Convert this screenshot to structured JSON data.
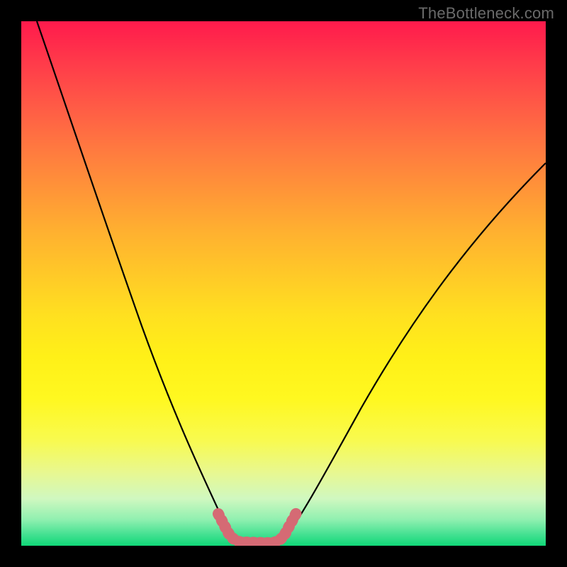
{
  "watermark": "TheBottleneck.com",
  "chart_data": {
    "type": "line",
    "title": "",
    "xlabel": "",
    "ylabel": "",
    "xlim": [
      0,
      100
    ],
    "ylim": [
      0,
      100
    ],
    "grid": false,
    "legend": false,
    "series": [
      {
        "name": "left-curve",
        "x": [
          3,
          10,
          18,
          25,
          30,
          35,
          40
        ],
        "y": [
          100,
          73,
          46,
          27,
          15,
          7,
          1
        ]
      },
      {
        "name": "right-curve",
        "x": [
          50,
          55,
          60,
          68,
          78,
          88,
          98
        ],
        "y": [
          1,
          6,
          14,
          28,
          45,
          60,
          73
        ]
      },
      {
        "name": "floor-band",
        "x": [
          38,
          40,
          43,
          47,
          50,
          52
        ],
        "y": [
          4,
          1,
          0,
          0,
          1,
          4
        ]
      }
    ],
    "colors": {
      "curve": "#000000",
      "floor_band": "#d56a74",
      "gradient_top": "#ff1a4c",
      "gradient_mid": "#fff018",
      "gradient_bottom": "#10d878"
    }
  }
}
